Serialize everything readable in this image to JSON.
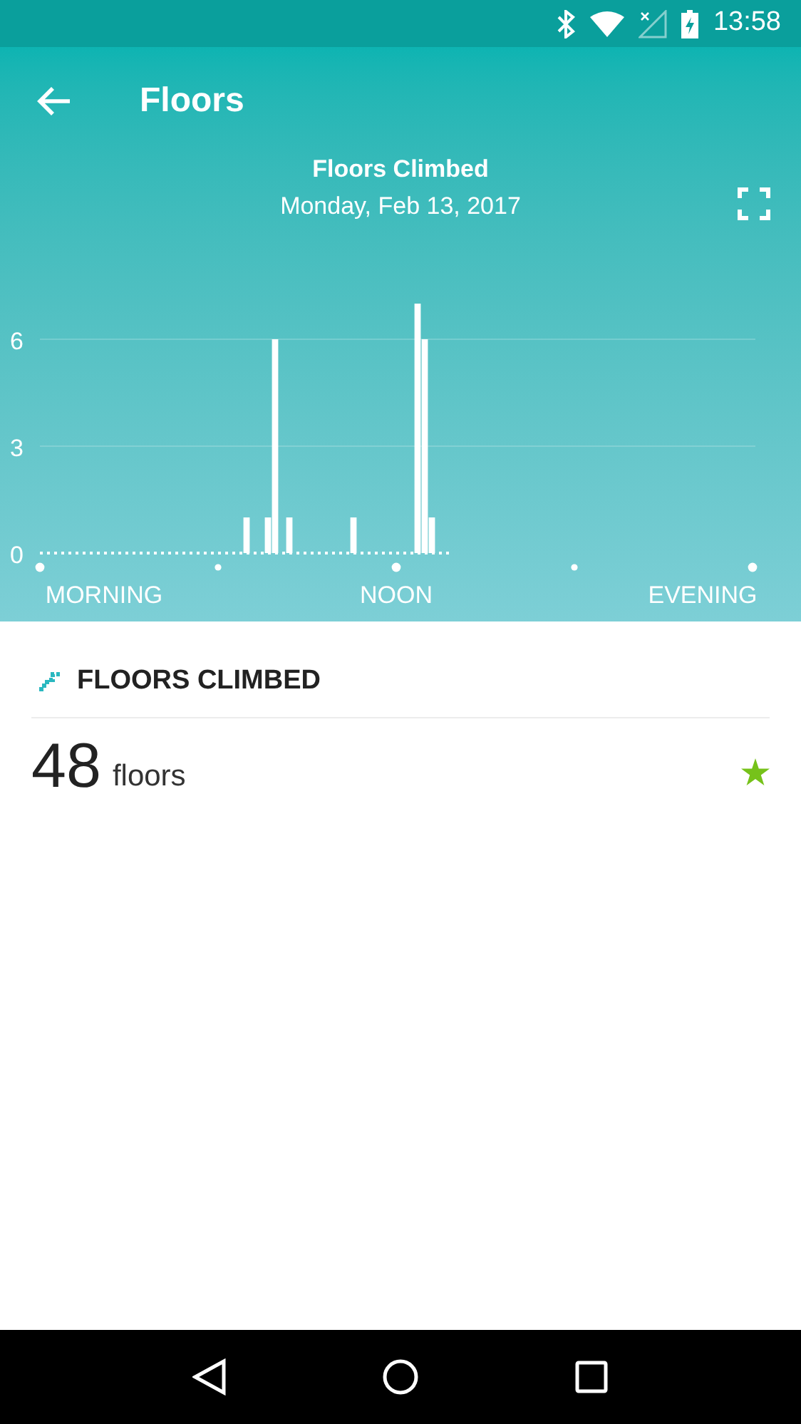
{
  "status_bar": {
    "time": "13:58"
  },
  "app_bar": {
    "title": "Floors"
  },
  "chart_header": {
    "title": "Floors Climbed",
    "date": "Monday, Feb 13, 2017"
  },
  "chart_data": {
    "type": "bar",
    "ylim": [
      0,
      7
    ],
    "yticks": [
      0,
      3,
      6
    ],
    "categories": [
      null,
      null,
      null,
      null,
      null,
      null,
      null,
      null,
      null,
      "MORNING",
      null,
      null,
      null,
      null,
      null,
      null,
      null,
      null,
      null,
      null,
      null,
      null,
      null,
      null,
      null,
      null,
      null,
      null,
      null,
      null,
      null,
      null,
      null,
      null,
      null,
      null,
      null,
      null,
      null,
      null,
      null,
      null,
      null,
      null,
      null,
      null,
      null,
      null,
      null,
      null,
      "NOON",
      null,
      null,
      null,
      null,
      null,
      null,
      null,
      null,
      null,
      null,
      null,
      null,
      null,
      null,
      null,
      null,
      null,
      null,
      null,
      null,
      null,
      null,
      null,
      null,
      null,
      null,
      null,
      null,
      null,
      null,
      null,
      null,
      null,
      null,
      null,
      null,
      null,
      null,
      null,
      null,
      null,
      null,
      "EVENING",
      null,
      null,
      null,
      null,
      null,
      null,
      null
    ],
    "values": [
      null,
      null,
      null,
      null,
      null,
      null,
      null,
      null,
      null,
      null,
      null,
      null,
      null,
      null,
      null,
      null,
      null,
      null,
      null,
      null,
      null,
      null,
      null,
      null,
      null,
      null,
      null,
      null,
      null,
      1,
      null,
      null,
      1,
      6,
      null,
      1,
      null,
      null,
      null,
      null,
      null,
      null,
      null,
      null,
      1,
      null,
      null,
      null,
      null,
      null,
      null,
      null,
      null,
      7,
      6,
      1,
      null,
      null,
      null,
      null,
      null,
      null,
      null,
      null,
      null,
      null,
      null,
      null,
      null,
      null,
      null,
      null,
      null,
      null,
      null,
      null,
      null,
      null,
      null,
      null,
      null,
      null,
      null,
      null,
      null,
      null,
      null,
      null,
      null,
      null,
      null,
      null,
      null,
      null,
      null,
      null,
      null,
      null,
      null,
      null,
      null
    ]
  },
  "summary": {
    "heading": "FLOORS CLIMBED",
    "value": "48",
    "unit": "floors",
    "goal_met": true
  }
}
